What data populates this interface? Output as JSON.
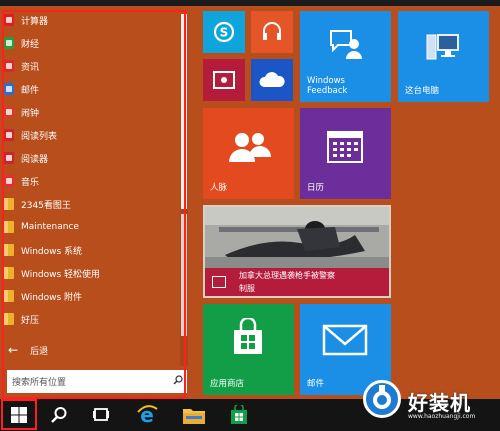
{
  "apps": [
    {
      "label": "计算器",
      "color": "#e01e1e",
      "kind": "app"
    },
    {
      "label": "财经",
      "color": "#2c9a3e",
      "kind": "app"
    },
    {
      "label": "资讯",
      "color": "#d42b2b",
      "kind": "app"
    },
    {
      "label": "邮件",
      "color": "#2d6ed1",
      "kind": "app"
    },
    {
      "label": "闹钟",
      "color": "#d63a2b",
      "kind": "app"
    },
    {
      "label": "阅读列表",
      "color": "#c8262a",
      "kind": "app"
    },
    {
      "label": "阅读器",
      "color": "#c8262a",
      "kind": "app"
    },
    {
      "label": "音乐",
      "color": "#e22f2f",
      "kind": "app"
    },
    {
      "label": "2345看图王",
      "color": "#f0b12a",
      "kind": "folder"
    },
    {
      "label": "Maintenance",
      "color": "#f0b12a",
      "kind": "folder"
    },
    {
      "label": "Windows 系统",
      "color": "#f0b12a",
      "kind": "folder"
    },
    {
      "label": "Windows 轻松使用",
      "color": "#f0b12a",
      "kind": "folder"
    },
    {
      "label": "Windows 附件",
      "color": "#f0b12a",
      "kind": "folder"
    },
    {
      "label": "好压",
      "color": "#f0b12a",
      "kind": "folder"
    }
  ],
  "back": {
    "arrow": "←",
    "label": "后退"
  },
  "search": {
    "placeholder": "搜索所有位置",
    "icon": "search-icon"
  },
  "tiles": {
    "windows_feedback": "Windows Feedback",
    "this_pc": "这台电脑",
    "people": "人脉",
    "calendar": "日历",
    "news_headline_line1": "加拿大总理遇袭枪手被警察",
    "news_headline_line2": "制服",
    "store": "应用商店",
    "mail": "邮件"
  },
  "watermark": {
    "text": "好装机",
    "sub": "www.haozhuangji.com"
  },
  "colors": {
    "accent": "#b84e1c",
    "tile_blue": "#1b8ee6",
    "tile_orange": "#e34a1f",
    "tile_purple": "#6c2e9a",
    "tile_crimson": "#b51c3c",
    "tile_green": "#129e47",
    "tile_skype": "#0fa5dc",
    "tile_darkblue": "#1c56c6",
    "tile_music": "#e45528",
    "highlight": "#ff1f1f"
  }
}
